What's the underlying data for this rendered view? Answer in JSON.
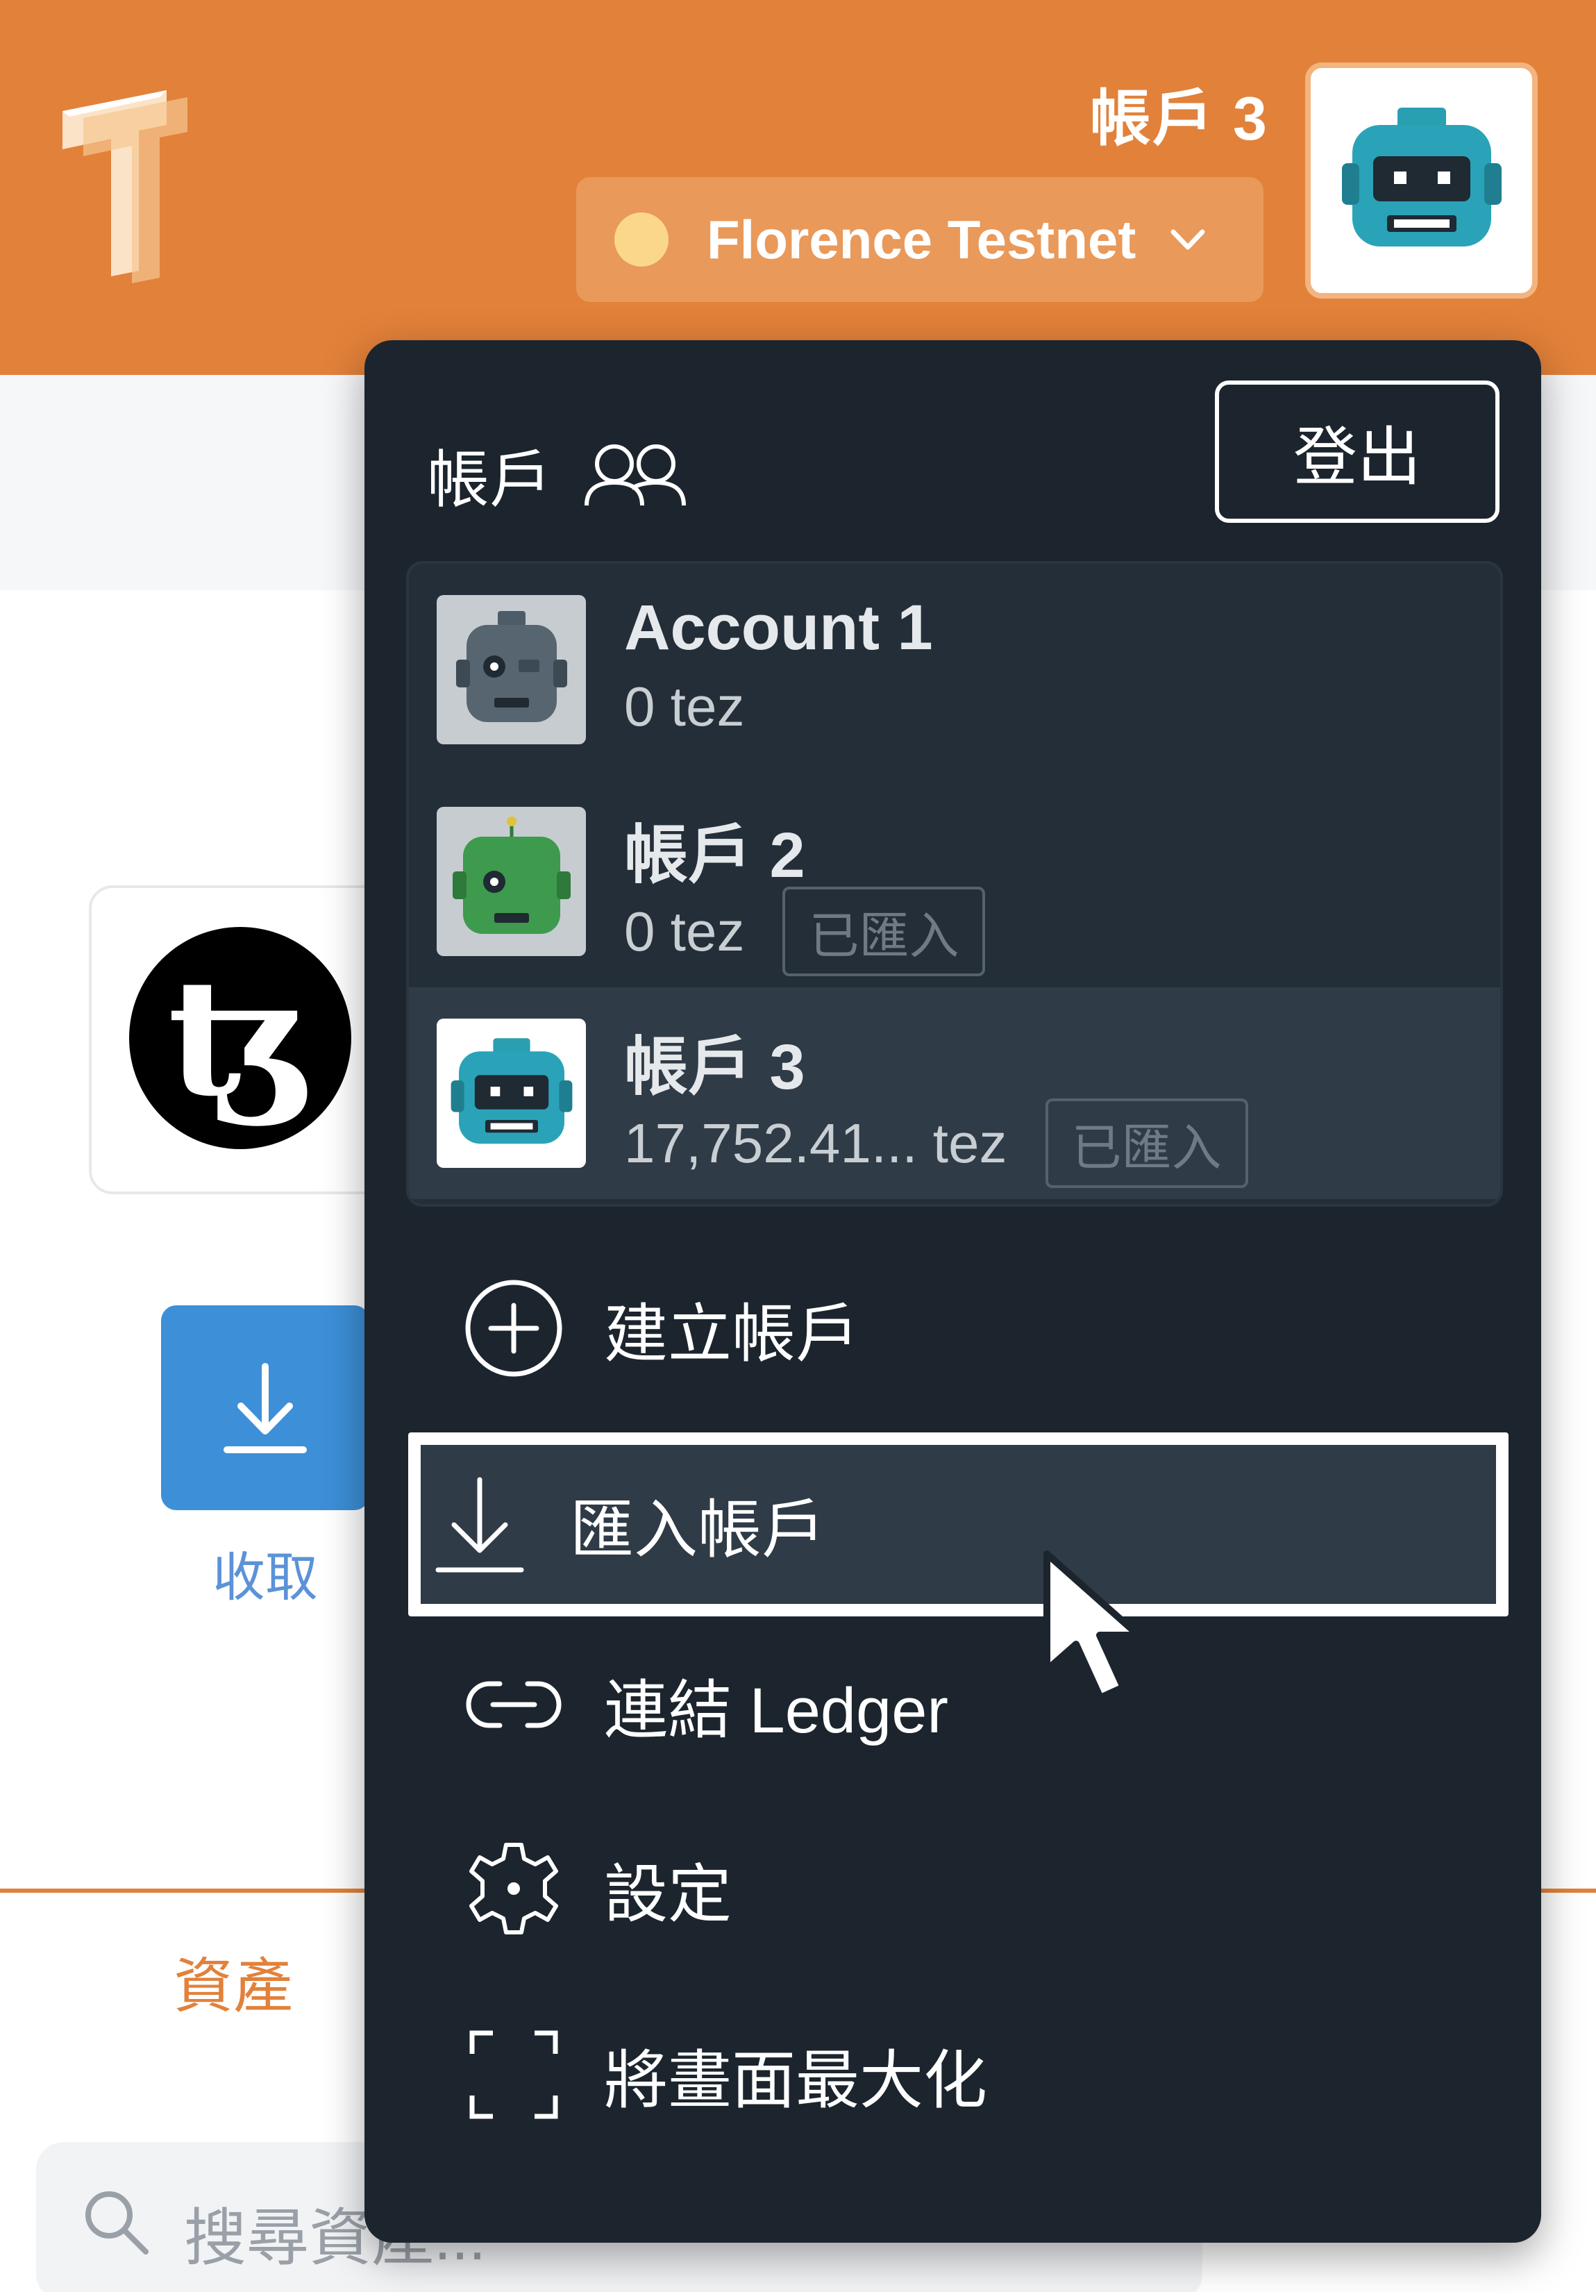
{
  "header": {
    "account_name": "帳戶 3",
    "network_label": "Florence Testnet",
    "colors": {
      "brand": "#e2813a",
      "network_dot": "#fbd78c"
    }
  },
  "background_page": {
    "receive_label": "收取",
    "assets_tab": "資產",
    "search_placeholder": "搜尋資產..."
  },
  "menu": {
    "title": "帳戶",
    "logout_label": "登出",
    "accounts": [
      {
        "name": "Account 1",
        "balance": "0 tez",
        "badge": "",
        "selected": false
      },
      {
        "name": "帳戶 2",
        "balance": "0 tez",
        "badge": "已匯入",
        "selected": false
      },
      {
        "name": "帳戶 3",
        "balance": "17,752.41... tez",
        "badge": "已匯入",
        "selected": true
      }
    ],
    "items": [
      {
        "label": "建立帳戶",
        "icon": "plus-circle-icon"
      },
      {
        "label": "匯入帳戶",
        "icon": "download-icon",
        "highlighted": true
      },
      {
        "label": "連結 Ledger",
        "icon": "link-icon"
      },
      {
        "label": "設定",
        "icon": "gear-icon"
      },
      {
        "label": "將畫面最大化",
        "icon": "maximize-icon"
      }
    ]
  }
}
